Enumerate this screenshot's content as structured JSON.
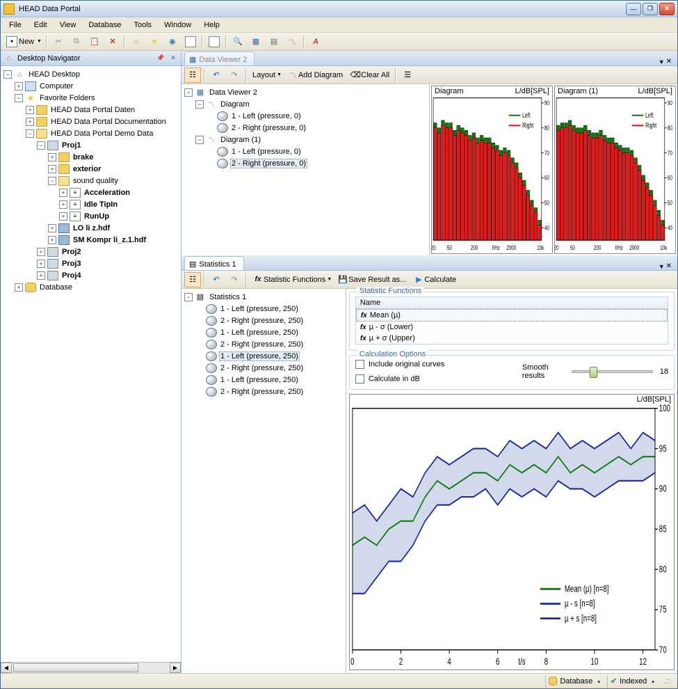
{
  "app": {
    "title": "HEAD Data Portal"
  },
  "menu": [
    "File",
    "Edit",
    "View",
    "Database",
    "Tools",
    "Window",
    "Help"
  ],
  "toolbar": {
    "new": "New"
  },
  "navigator": {
    "title": "Desktop Navigator",
    "root": "HEAD Desktop",
    "computer": "Computer",
    "fav": "Favorite Folders",
    "fav_items": {
      "daten": "HEAD Data Portal Daten",
      "docs": "HEAD Data Portal Documentation",
      "demo": "HEAD Data Portal Demo Data"
    },
    "projects": {
      "p1": "Proj1",
      "p1_children": {
        "brake": "brake",
        "exterior": "exterior",
        "sq": "sound quality",
        "sq_children": {
          "accel": "Acceleration",
          "tipin": "Idle TipIn",
          "runup": "RunUp"
        },
        "file1": "LO li z.hdf",
        "file2": "SM Kompr li_z.1.hdf"
      },
      "p2": "Proj2",
      "p3": "Proj3",
      "p4": "Proj4"
    },
    "database": "Database"
  },
  "dataviewer": {
    "tab": "Data Viewer 2",
    "toolbar": {
      "layout": "Layout",
      "add": "Add Diagram",
      "clear": "Clear All"
    },
    "tree": {
      "root": "Data Viewer 2",
      "d1": "Diagram",
      "d1_c1": "1 - Left (pressure, 0)",
      "d1_c2": "2 - Right (pressure, 0)",
      "d2": "Diagram (1)",
      "d2_c1": "1 - Left (pressure, 0)",
      "d2_c2": "2 - Right (pressure, 0)"
    },
    "chart1": {
      "title": "Diagram",
      "ylabel_top": "L/dB[SPL]",
      "legend_left": "Left",
      "legend_right": "Right"
    },
    "chart2": {
      "title": "Diagram (1)",
      "ylabel_top": "L/dB[SPL]",
      "legend_left": "Left",
      "legend_right": "Right"
    }
  },
  "statistics": {
    "tab": "Statistics 1",
    "toolbar": {
      "fns": "Statistic Functions",
      "save": "Save Result as...",
      "calc": "Calculate"
    },
    "tree": {
      "root": "Statistics 1",
      "items": [
        "1 - Left (pressure, 250)",
        "2 - Right (pressure, 250)",
        "1 - Left (pressure, 250)",
        "2 - Right (pressure, 250)",
        "1 - Left (pressure, 250)",
        "2 - Right (pressure, 250)",
        "1 - Left (pressure, 250)",
        "2 - Right (pressure, 250)"
      ]
    },
    "functions": {
      "group_title": "Statistic Functions",
      "header": "Name",
      "rows": [
        "Mean (µ)",
        "µ - σ (Lower)",
        "µ + σ (Upper)"
      ]
    },
    "options": {
      "group_title": "Calculation Options",
      "incl_orig": "Include original curves",
      "calc_db": "Calculate in dB",
      "smooth_label": "Smooth results",
      "smooth_value": "18"
    },
    "result_chart": {
      "ylabel_top": "L/dB[SPL]",
      "legend": {
        "mean": "Mean (µ)  [n=8]",
        "lower": "µ - s  [n=8]",
        "upper": "µ + s  [n=8]"
      }
    }
  },
  "statusbar": {
    "database": "Database",
    "indexed": "Indexed"
  },
  "chart_data": [
    {
      "type": "bar",
      "title": "Diagram",
      "xlabel": "f/Hz",
      "ylabel": "L/dB[SPL]",
      "x_scale": "log",
      "x_ticks": [
        20,
        50,
        200,
        2000,
        "10k"
      ],
      "y_ticks": [
        40,
        50,
        60,
        70,
        80,
        90
      ],
      "ylim": [
        35,
        92
      ],
      "categories_hz": [
        20,
        25,
        31.5,
        40,
        50,
        63,
        80,
        100,
        125,
        160,
        200,
        250,
        315,
        400,
        500,
        630,
        800,
        1000,
        1250,
        1600,
        2000,
        2500,
        3150,
        4000,
        5000,
        6300,
        8000,
        10000
      ],
      "series": [
        {
          "name": "Left",
          "color": "#0e7a10",
          "values": [
            82,
            80,
            83,
            82,
            82,
            79,
            81,
            80,
            79,
            77,
            78,
            76,
            77,
            76,
            76,
            74,
            73,
            71,
            72,
            71,
            68,
            66,
            62,
            59,
            55,
            51,
            48,
            43
          ]
        },
        {
          "name": "Right",
          "color": "#e31a1c",
          "values": [
            80,
            78,
            81,
            80,
            80,
            77,
            79,
            78,
            77,
            75,
            76,
            74,
            75,
            74,
            74,
            72,
            71,
            69,
            70,
            69,
            66,
            64,
            60,
            57,
            53,
            49,
            46,
            41
          ]
        }
      ]
    },
    {
      "type": "bar",
      "title": "Diagram (1)",
      "xlabel": "f/Hz",
      "ylabel": "L/dB[SPL]",
      "x_scale": "log",
      "x_ticks": [
        20,
        50,
        200,
        2000,
        "10k"
      ],
      "y_ticks": [
        40,
        50,
        60,
        70,
        80,
        90
      ],
      "ylim": [
        35,
        92
      ],
      "categories_hz": [
        20,
        25,
        31.5,
        40,
        50,
        63,
        80,
        100,
        125,
        160,
        200,
        250,
        315,
        400,
        500,
        630,
        800,
        1000,
        1250,
        1600,
        2000,
        2500,
        3150,
        4000,
        5000,
        6300,
        8000,
        10000
      ],
      "series": [
        {
          "name": "Left",
          "color": "#0e7a10",
          "values": [
            81,
            82,
            82,
            83,
            81,
            80,
            80,
            81,
            79,
            78,
            78,
            79,
            77,
            76,
            76,
            74,
            73,
            72,
            72,
            71,
            68,
            65,
            61,
            58,
            55,
            51,
            47,
            43
          ]
        },
        {
          "name": "Right",
          "color": "#e31a1c",
          "values": [
            79,
            80,
            80,
            81,
            79,
            78,
            78,
            79,
            77,
            76,
            76,
            77,
            75,
            74,
            74,
            72,
            71,
            70,
            70,
            69,
            66,
            63,
            59,
            56,
            53,
            49,
            45,
            41
          ]
        }
      ]
    },
    {
      "type": "line",
      "title": "",
      "xlabel": "t/s",
      "ylabel": "L/dB[SPL]",
      "x_ticks": [
        0,
        2,
        4,
        6,
        8,
        10,
        12
      ],
      "y_ticks": [
        70,
        75,
        80,
        85,
        90,
        95,
        100
      ],
      "xlim": [
        0,
        12.5
      ],
      "ylim": [
        70,
        100
      ],
      "series": [
        {
          "name": "µ + s  [n=8]",
          "color": "#1a2a9a",
          "x": [
            0,
            0.5,
            1,
            1.5,
            2,
            2.5,
            3,
            3.5,
            4,
            4.5,
            5,
            5.5,
            6,
            6.5,
            7,
            7.5,
            8,
            8.5,
            9,
            9.5,
            10,
            10.5,
            11,
            11.5,
            12,
            12.5
          ],
          "y": [
            87,
            88,
            86,
            88,
            90,
            89,
            92,
            94,
            93,
            94,
            95,
            95,
            94,
            96,
            95,
            96,
            95,
            97,
            95,
            96,
            95,
            96,
            97,
            95,
            97,
            96
          ]
        },
        {
          "name": "Mean (µ)  [n=8]",
          "color": "#0e7a10",
          "x": [
            0,
            0.5,
            1,
            1.5,
            2,
            2.5,
            3,
            3.5,
            4,
            4.5,
            5,
            5.5,
            6,
            6.5,
            7,
            7.5,
            8,
            8.5,
            9,
            9.5,
            10,
            10.5,
            11,
            11.5,
            12,
            12.5
          ],
          "y": [
            83,
            84,
            83,
            85,
            86,
            86,
            89,
            91,
            90,
            91,
            92,
            92,
            91,
            93,
            92,
            93,
            92,
            94,
            92,
            93,
            92,
            93,
            94,
            93,
            94,
            94
          ]
        },
        {
          "name": "µ - s  [n=8]",
          "color": "#1a2a9a",
          "x": [
            0,
            0.5,
            1,
            1.5,
            2,
            2.5,
            3,
            3.5,
            4,
            4.5,
            5,
            5.5,
            6,
            6.5,
            7,
            7.5,
            8,
            8.5,
            9,
            9.5,
            10,
            10.5,
            11,
            11.5,
            12,
            12.5
          ],
          "y": [
            77,
            77,
            79,
            81,
            81,
            83,
            86,
            88,
            88,
            89,
            89,
            90,
            88,
            90,
            89,
            90,
            89,
            91,
            90,
            90,
            89,
            90,
            91,
            91,
            91,
            92
          ]
        }
      ]
    }
  ]
}
